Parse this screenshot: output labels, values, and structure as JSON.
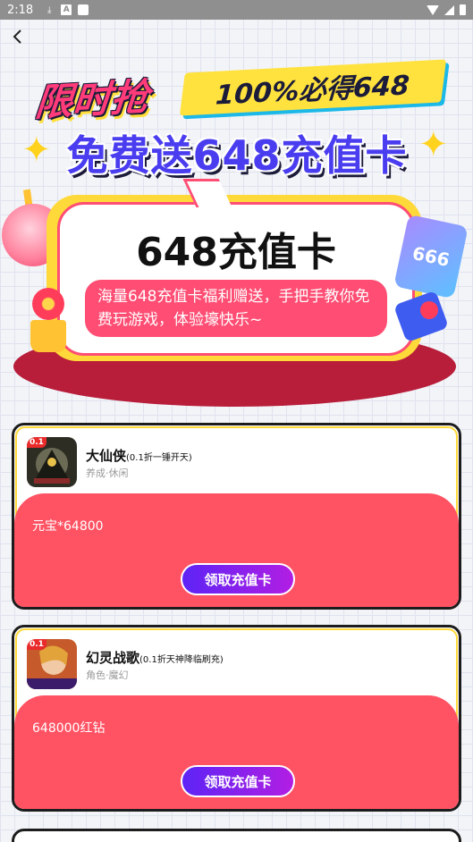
{
  "status_bar": {
    "time": "2:18",
    "icons": [
      "download-icon",
      "a-icon",
      "square-icon",
      "wifi-icon",
      "cell-signal-icon",
      "battery-icon"
    ]
  },
  "banner": {
    "headline": "限时抢",
    "tag": "100%必得648",
    "subheadline": "免费送648充值卡",
    "card_title": "648充值卡",
    "description": "海量648充值卡福利赠送，手把手教你免费玩游戏，体验壕快乐~",
    "deco_card_text": "666",
    "colors": {
      "pink": "#ff3b7a",
      "purple": "#4a3df0",
      "yellow": "#ffe23d",
      "red": "#ff5364",
      "stage": "#b81d3a"
    }
  },
  "games": [
    {
      "name": "大仙侠",
      "subtitle": "(0.1折一锤开天)",
      "tags": "养成·休闲",
      "badge": "0.1",
      "reward": "元宝*64800",
      "button": "领取充值卡"
    },
    {
      "name": "幻灵战歌",
      "subtitle": "(0.1折天神降临刷充)",
      "tags": "角色·魔幻",
      "badge": "0.1",
      "reward": "648000红钻",
      "button": "领取充值卡"
    }
  ]
}
